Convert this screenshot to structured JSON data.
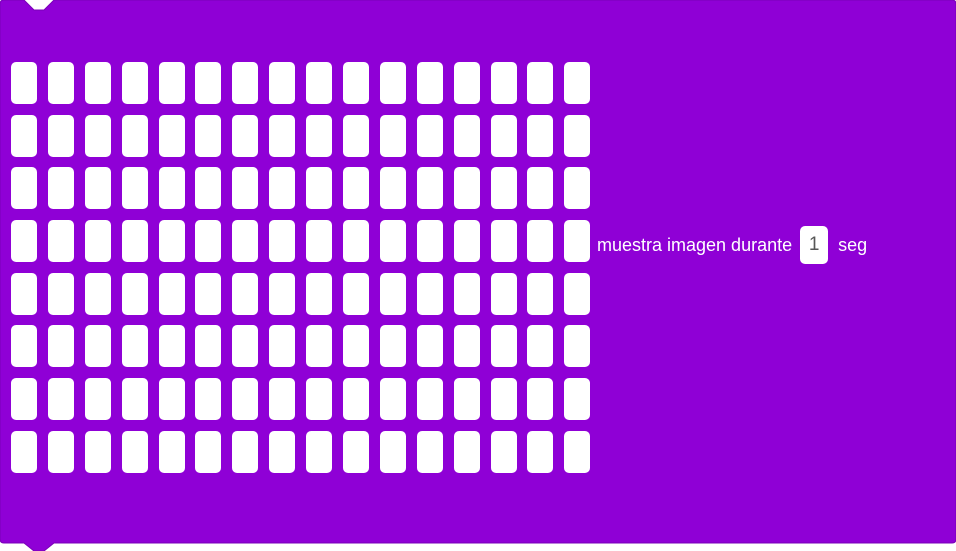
{
  "block": {
    "color": "#8f00d6",
    "border_color": "#7a00b8",
    "label_before": "muestra imagen durante",
    "duration_value": "1",
    "label_after": "seg"
  },
  "matrix": {
    "columns": 16,
    "rows": 8,
    "led_off_color": "#ffffff",
    "led_on_color": "#3b0a63",
    "pixels": [
      [
        0,
        0,
        0,
        0,
        0,
        0,
        0,
        0,
        0,
        0,
        0,
        0,
        0,
        0,
        0,
        0
      ],
      [
        0,
        0,
        0,
        0,
        0,
        0,
        0,
        0,
        0,
        0,
        0,
        0,
        0,
        0,
        0,
        0
      ],
      [
        0,
        0,
        0,
        0,
        0,
        0,
        0,
        0,
        0,
        0,
        0,
        0,
        0,
        0,
        0,
        0
      ],
      [
        0,
        0,
        0,
        0,
        0,
        0,
        0,
        0,
        0,
        0,
        0,
        0,
        0,
        0,
        0,
        0
      ],
      [
        0,
        0,
        0,
        0,
        0,
        0,
        0,
        0,
        0,
        0,
        0,
        0,
        0,
        0,
        0,
        0
      ],
      [
        0,
        0,
        0,
        0,
        0,
        0,
        0,
        0,
        0,
        0,
        0,
        0,
        0,
        0,
        0,
        0
      ],
      [
        0,
        0,
        0,
        0,
        0,
        0,
        0,
        0,
        0,
        0,
        0,
        0,
        0,
        0,
        0,
        0
      ],
      [
        0,
        0,
        0,
        0,
        0,
        0,
        0,
        0,
        0,
        0,
        0,
        0,
        0,
        0,
        0,
        0
      ]
    ]
  }
}
